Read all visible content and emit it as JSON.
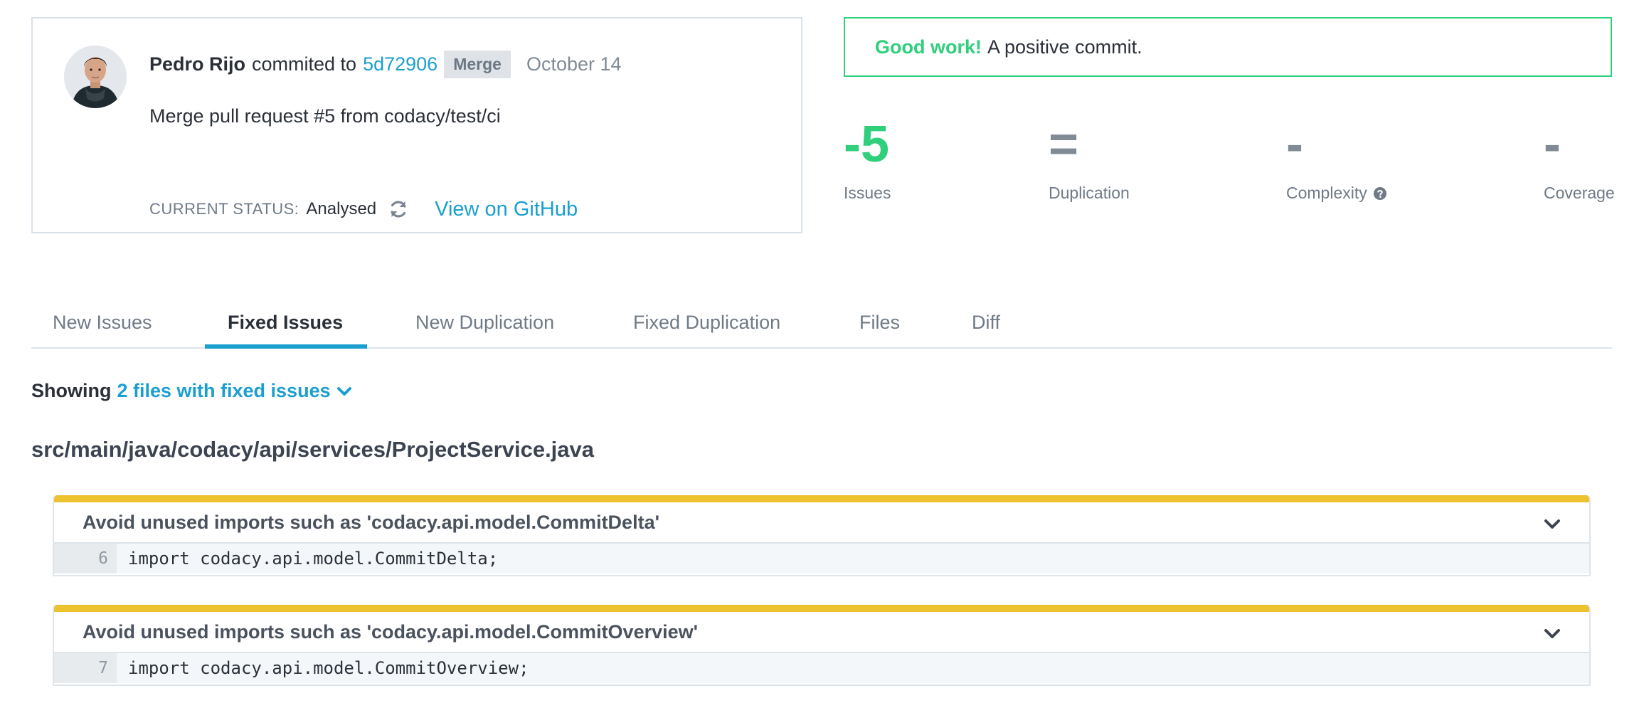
{
  "commit": {
    "author": "Pedro Rijo",
    "verb": "commited to",
    "sha": "5d72906",
    "badge": "Merge",
    "date": "October 14",
    "message": "Merge pull request #5 from codacy/test/ci",
    "status_label": "CURRENT STATUS:",
    "status_value": "Analysed",
    "github_link": "View on GitHub"
  },
  "banner": {
    "strong": "Good work!",
    "text": "A positive commit."
  },
  "metrics": [
    {
      "value": "-5",
      "label": "Issues"
    },
    {
      "value": "=",
      "label": "Duplication"
    },
    {
      "value": "-",
      "label": "Complexity"
    },
    {
      "value": "-",
      "label": "Coverage"
    }
  ],
  "tabs": [
    {
      "label": "New Issues"
    },
    {
      "label": "Fixed Issues"
    },
    {
      "label": "New Duplication"
    },
    {
      "label": "Fixed Duplication"
    },
    {
      "label": "Files"
    },
    {
      "label": "Diff"
    }
  ],
  "active_tab": "Fixed Issues",
  "showing": {
    "label": "Showing",
    "link": "2 files with fixed issues"
  },
  "file": {
    "path": "src/main/java/codacy/api/services/ProjectService.java",
    "issues": [
      {
        "title": "Avoid unused imports such as 'codacy.api.model.CommitDelta'",
        "line": "6",
        "code": "import codacy.api.model.CommitDelta;"
      },
      {
        "title": "Avoid unused imports such as 'codacy.api.model.CommitOverview'",
        "line": "7",
        "code": "import codacy.api.model.CommitOverview;"
      }
    ]
  },
  "colors": {
    "accent": "#1a9fcf",
    "positive": "#2fcf7c",
    "issue_bar": "#ecc22e"
  },
  "icons": {
    "refresh": "refresh-icon",
    "help": "question-circle-icon",
    "chevron": "chevron-down-icon"
  }
}
